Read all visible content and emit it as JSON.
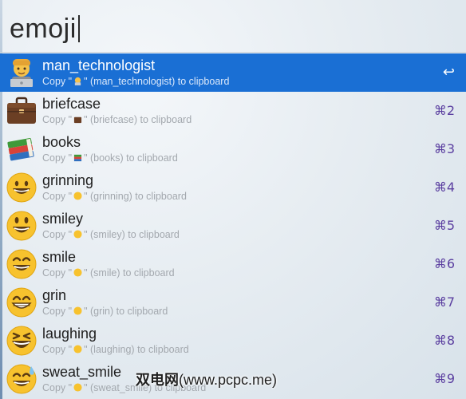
{
  "search": {
    "value": "emoji"
  },
  "results": [
    {
      "name": "man_technologist",
      "emoji_icon": "man-technologist-icon",
      "subtitle_prefix": "Copy \"",
      "subtitle_suffix": "\" (man_technologist) to clipboard",
      "shortcut": "↩"
    },
    {
      "name": "briefcase",
      "emoji_icon": "briefcase-icon",
      "subtitle_prefix": "Copy \"",
      "subtitle_suffix": "\" (briefcase) to clipboard",
      "shortcut": "⌘2"
    },
    {
      "name": "books",
      "emoji_icon": "books-icon",
      "subtitle_prefix": "Copy \"",
      "subtitle_suffix": "\" (books) to clipboard",
      "shortcut": "⌘3"
    },
    {
      "name": "grinning",
      "emoji_icon": "grinning-face-icon",
      "subtitle_prefix": "Copy \"",
      "subtitle_suffix": "\" (grinning) to clipboard",
      "shortcut": "⌘4"
    },
    {
      "name": "smiley",
      "emoji_icon": "smiley-face-icon",
      "subtitle_prefix": "Copy \"",
      "subtitle_suffix": "\" (smiley) to clipboard",
      "shortcut": "⌘5"
    },
    {
      "name": "smile",
      "emoji_icon": "smile-face-icon",
      "subtitle_prefix": "Copy \"",
      "subtitle_suffix": "\" (smile) to clipboard",
      "shortcut": "⌘6"
    },
    {
      "name": "grin",
      "emoji_icon": "grin-face-icon",
      "subtitle_prefix": "Copy \"",
      "subtitle_suffix": "\" (grin) to clipboard",
      "shortcut": "⌘7"
    },
    {
      "name": "laughing",
      "emoji_icon": "laughing-face-icon",
      "subtitle_prefix": "Copy \"",
      "subtitle_suffix": "\" (laughing) to clipboard",
      "shortcut": "⌘8"
    },
    {
      "name": "sweat_smile",
      "emoji_icon": "sweat-smile-face-icon",
      "subtitle_prefix": "Copy \"",
      "subtitle_suffix": "\" (sweat_smile) to clipboard",
      "shortcut": "⌘9"
    }
  ],
  "watermark": {
    "text_cn": "双电网",
    "text_url": "(www.pcpc.me)"
  },
  "colors": {
    "selection": "#1a6fd4",
    "shortcut": "#5b3fa0",
    "face_yellow": "#f7c22e"
  }
}
